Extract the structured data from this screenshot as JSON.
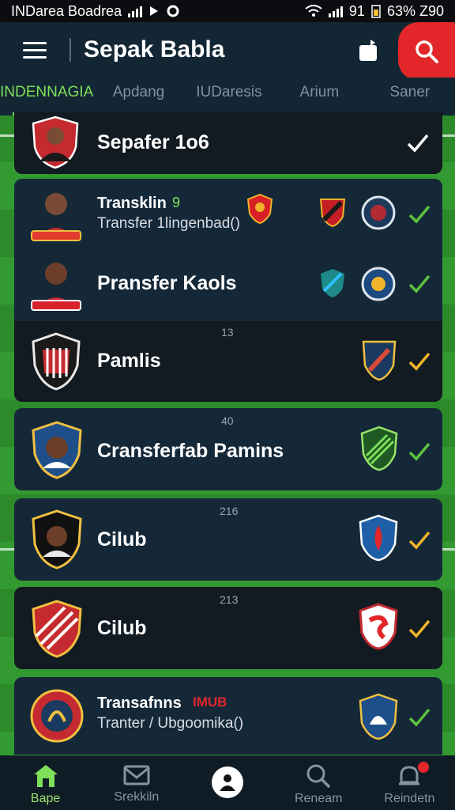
{
  "status_bar": {
    "left_text": "INDarea Boadrea",
    "right_text": "63% Z90",
    "signal_text": "91"
  },
  "app_bar": {
    "title": "Sepak Babla"
  },
  "tabs": [
    {
      "label": "INDENNAGIA",
      "active": true
    },
    {
      "label": "Apdang",
      "active": false
    },
    {
      "label": "IUDaresis",
      "active": false
    },
    {
      "label": "Arium",
      "active": false
    },
    {
      "label": "Saner",
      "active": false
    }
  ],
  "items": [
    {
      "title": "Sepafer 1o6",
      "count": ""
    },
    {
      "title": "Transklin",
      "title_badge": "9",
      "subtitle": "Transfer 1lingenbad()",
      "count": ""
    },
    {
      "title": "Pransfer Kaols",
      "count": ""
    },
    {
      "title": "Pamlis",
      "count": "13"
    },
    {
      "title": "Cransferfab Pamins",
      "count": "40"
    },
    {
      "title": "Cilub",
      "count": "216"
    },
    {
      "title": "Cilub",
      "count": "213"
    },
    {
      "title": "Transafnns",
      "title_badge": "IMUB",
      "subtitle": "Tranter / Ubgoomika()",
      "count": ""
    }
  ],
  "bottom_nav": [
    {
      "label": "Bape",
      "icon": "home-icon",
      "active": true
    },
    {
      "label": "Srekkiln",
      "icon": "mail-icon",
      "active": false
    },
    {
      "label": "",
      "icon": "profile-icon",
      "active": false
    },
    {
      "label": "Reneam",
      "icon": "search-icon",
      "active": false
    },
    {
      "label": "Reindetn",
      "icon": "bell-icon",
      "active": false
    }
  ],
  "colors": {
    "accent_green": "#72d050",
    "accent_red": "#e3262a",
    "check_green": "#5cc23d",
    "check_yellow": "#f0b52a",
    "header_bg": "#122633"
  }
}
